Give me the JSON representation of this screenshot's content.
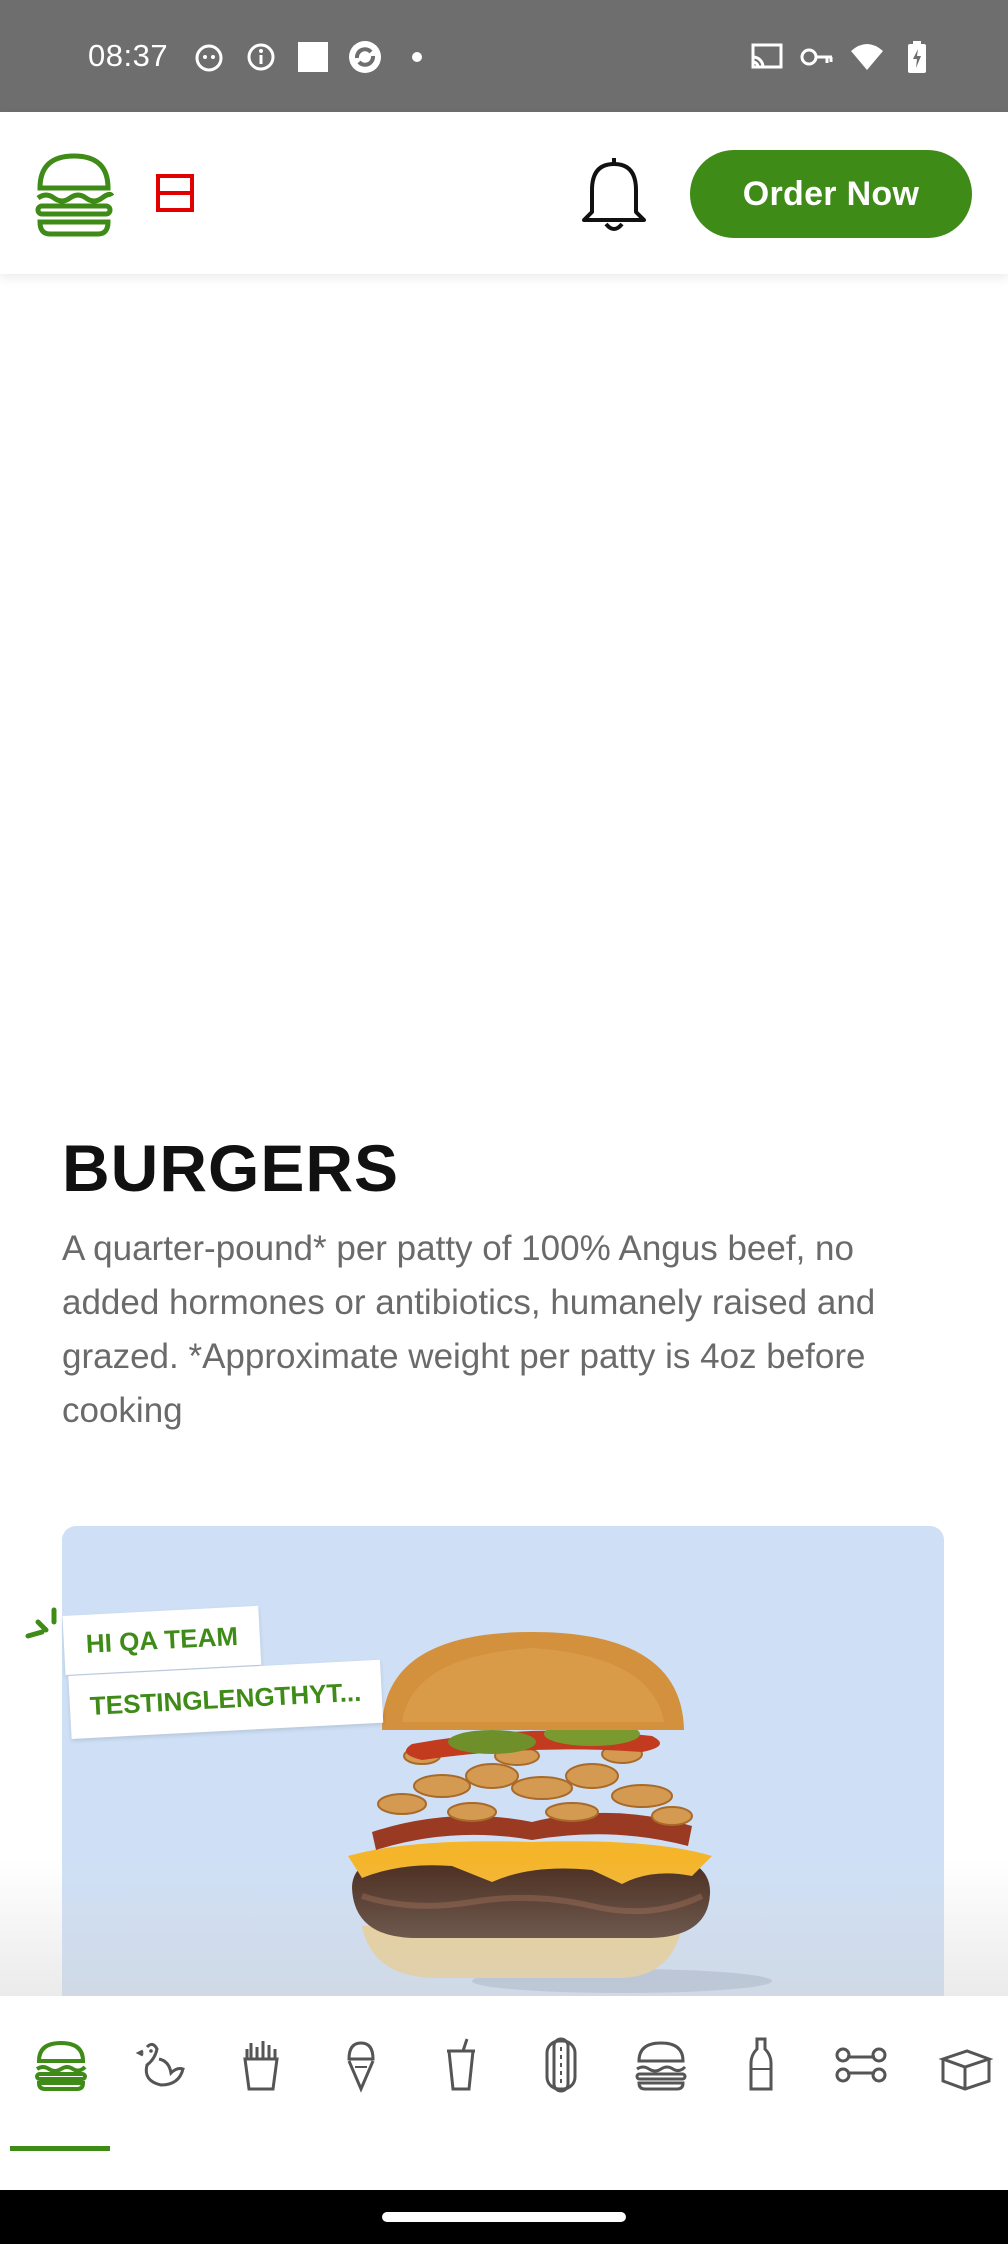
{
  "status_bar": {
    "time": "08:37",
    "left_icons": [
      "cat-notification-icon",
      "info-icon",
      "square-icon",
      "sync-icon",
      "dot-icon"
    ],
    "right_icons": [
      "cast-icon",
      "vpn-key-icon",
      "wifi-icon",
      "battery-charging-icon"
    ]
  },
  "header": {
    "order_button_label": "Order Now"
  },
  "colors": {
    "brand_green": "#3f8b17",
    "card_background": "#cfe0f6"
  },
  "section": {
    "title": "BURGERS",
    "description": "A quarter-pound* per patty of 100% Angus beef, no added hormones or antibiotics, humanely raised and grazed. *Approximate weight per patty is 4oz before cooking"
  },
  "product_card": {
    "sticker_1": "HI QA TEAM",
    "sticker_2": "TESTINGLENGTHYT..."
  },
  "categories": [
    {
      "icon": "burger-icon",
      "selected": true
    },
    {
      "icon": "chicken-icon",
      "selected": false
    },
    {
      "icon": "fries-icon",
      "selected": false
    },
    {
      "icon": "ice-cream-cone-icon",
      "selected": false
    },
    {
      "icon": "drink-cup-icon",
      "selected": false
    },
    {
      "icon": "hot-dog-icon",
      "selected": false
    },
    {
      "icon": "burger-outline-icon",
      "selected": false
    },
    {
      "icon": "bottle-icon",
      "selected": false
    },
    {
      "icon": "dog-bone-icon",
      "selected": false
    },
    {
      "icon": "box-icon",
      "selected": false
    }
  ]
}
